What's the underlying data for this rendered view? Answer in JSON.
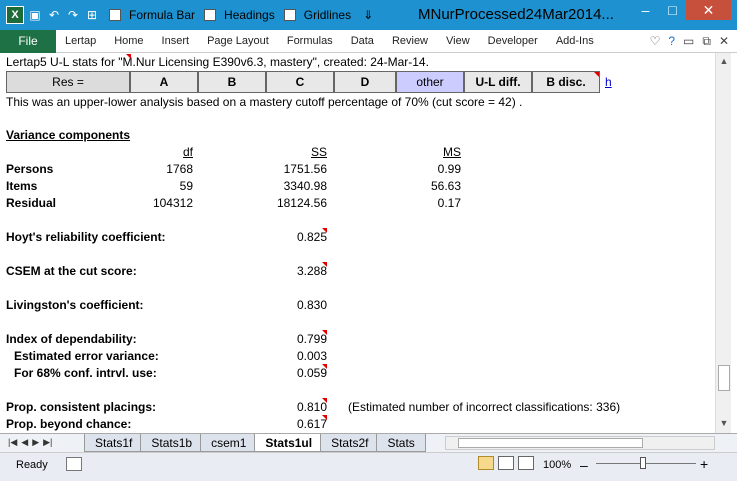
{
  "titlebar": {
    "formula_bar_label": "Formula Bar",
    "headings_label": "Headings",
    "gridlines_label": "Gridlines",
    "title": "MNurProcessed24Mar2014...",
    "minimize": "–",
    "maximize": "□",
    "close": "✕"
  },
  "ribbon": {
    "file": "File",
    "tabs": [
      "Lertap",
      "Home",
      "Insert",
      "Page Layout",
      "Formulas",
      "Data",
      "Review",
      "View",
      "Developer",
      "Add-Ins"
    ]
  },
  "sheet": {
    "header_line": "Lertap5 U-L stats for \"M.Nur Licensing E390v6.3, mastery\", created: 24-Mar-14.",
    "buttons": [
      "Res =",
      "A",
      "B",
      "C",
      "D",
      "other",
      "U-L diff.",
      "B disc."
    ],
    "link": "h",
    "intro": "This was an upper-lower analysis based on a mastery cutoff percentage of 70% (cut score = 42) .",
    "variance_title": "Variance components",
    "col_df": "df",
    "col_ss": "SS",
    "col_ms": "MS",
    "rows": [
      {
        "label": "Persons",
        "df": "1768",
        "ss": "1751.56",
        "ms": "0.99"
      },
      {
        "label": "Items",
        "df": "59",
        "ss": "3340.98",
        "ms": "56.63"
      },
      {
        "label": "Residual",
        "df": "104312",
        "ss": "18124.56",
        "ms": "0.17"
      }
    ],
    "hoyt_label": "Hoyt's reliability coefficient:",
    "hoyt_value": "0.825",
    "csem_label": "CSEM at the cut score:",
    "csem_value": "3.288",
    "livingston_label": "Livingston's coefficient:",
    "livingston_value": "0.830",
    "dep_label": "Index of dependability:",
    "dep_value": "0.799",
    "err_label": "Estimated error variance:",
    "err_value": "0.003",
    "conf_label": "For 68% conf. intrvl. use:",
    "conf_value": "0.059",
    "pcp_label": "Prop. consistent placings:",
    "pcp_value": "0.810",
    "pcp_note": "(Estimated number of incorrect classifications: 336)",
    "pbc_label": "Prop. beyond chance:",
    "pbc_value": "0.617"
  },
  "sheettabs": [
    "Stats1f",
    "Stats1b",
    "csem1",
    "Stats1ul",
    "Stats2f",
    "Stats"
  ],
  "active_tab": "Stats1ul",
  "status": {
    "ready": "Ready",
    "zoom": "100%",
    "zoom_minus": "–",
    "zoom_plus": "+"
  }
}
